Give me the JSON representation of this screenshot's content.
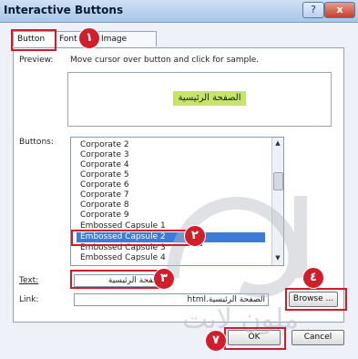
{
  "window": {
    "title": "Interactive Buttons",
    "help": "?",
    "close": "x"
  },
  "tabs": [
    {
      "label": "Button"
    },
    {
      "label": "Font"
    },
    {
      "label": "Image"
    }
  ],
  "preview": {
    "label": "Preview:",
    "hint": "Move cursor over button and click for sample.",
    "sample_text": "الصفحة الرئيسية"
  },
  "buttons": {
    "label": "Buttons:",
    "items": [
      "Corporate 2",
      "Corporate 3",
      "Corporate 4",
      "Corporate 5",
      "Corporate 6",
      "Corporate 7",
      "Corporate 8",
      "Corporate 9",
      "Embossed Capsule 1",
      "Embossed Capsule 2",
      "Embossed Capsule 3",
      "Embossed Capsule 4"
    ],
    "selected": "Embossed Capsule 2"
  },
  "text_field": {
    "label": "Text:",
    "value": "الصفحة الرئيسية"
  },
  "link_field": {
    "label": "Link:",
    "value": "الصفحة الرئيسية.html"
  },
  "actions": {
    "browse": "Browse ...",
    "ok": "OK",
    "cancel": "Cancel"
  },
  "markers": [
    "١",
    "٢",
    "٣",
    "٤",
    "٧"
  ],
  "watermark": {
    "text": "ملون لايت"
  }
}
